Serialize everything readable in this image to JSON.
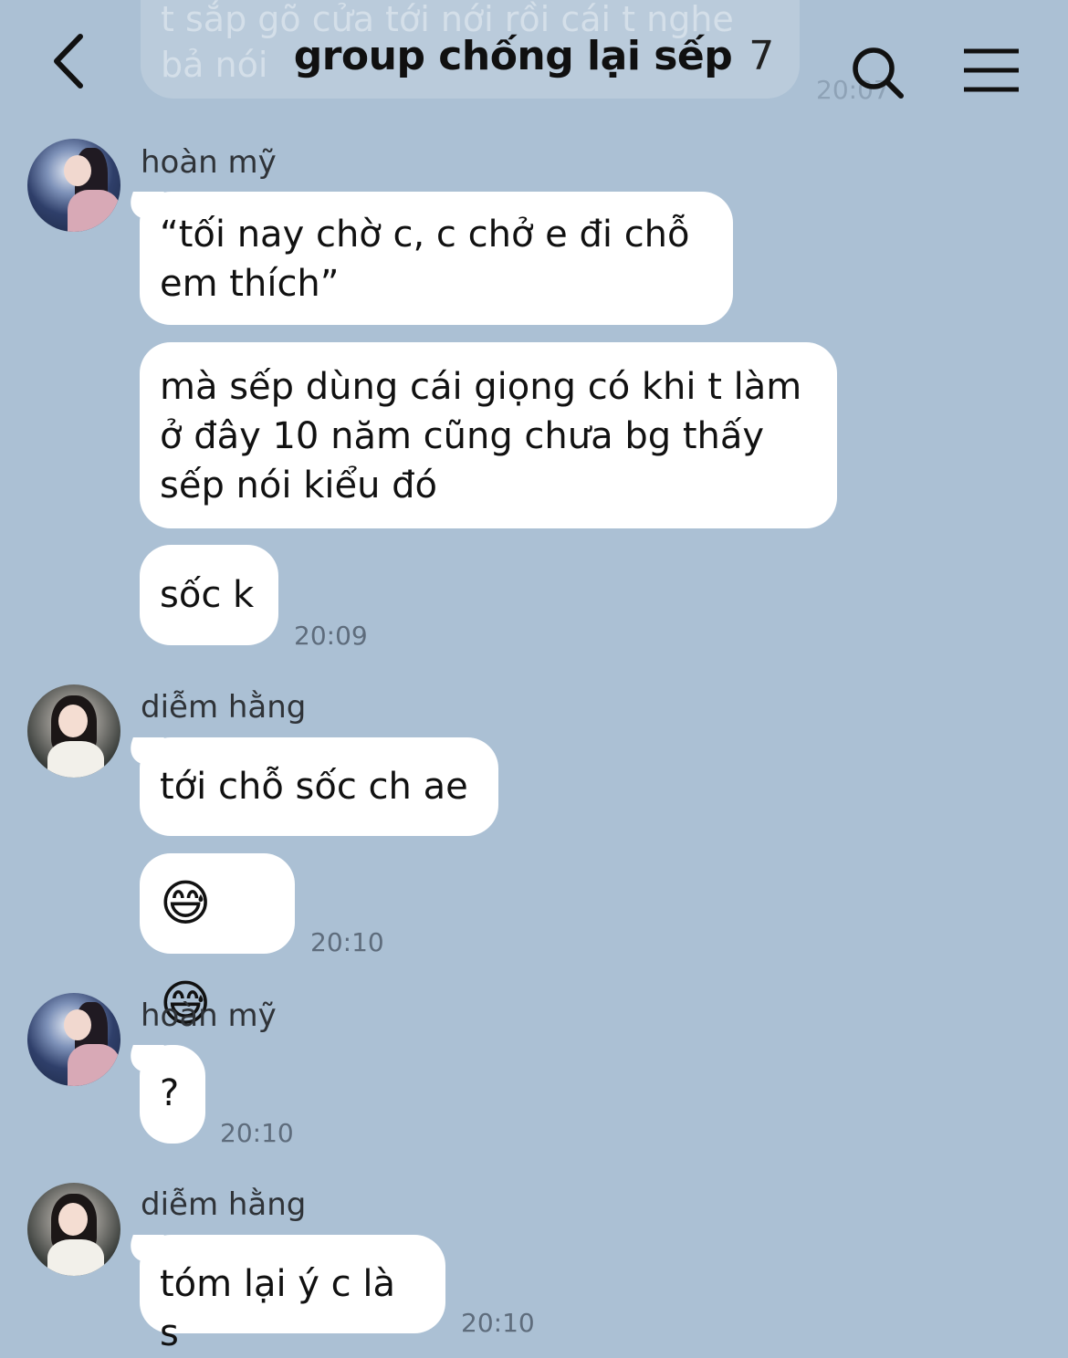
{
  "ghost": {
    "line1": "t sắp gõ cửa tới nới rồi cái t nghe",
    "line2": "bả nói",
    "time": "20:07"
  },
  "header": {
    "title": "group chống lại sếp",
    "member_count": "7",
    "back_icon": "chevron-left-icon",
    "search_icon": "search-icon",
    "menu_icon": "hamburger-menu-icon"
  },
  "messages": [
    {
      "sender": "hoàn mỹ",
      "bubbles": [
        {
          "text": "“tối nay chờ c, c chở e đi chỗ\nem thích”"
        },
        {
          "text": "mà sếp dùng cái giọng có khi t làm\nở đây 10 năm cũng chưa bg thấy\nsếp nói kiểu đó"
        },
        {
          "text": "sốc k",
          "time": "20:09"
        }
      ]
    },
    {
      "sender": "diễm hằng",
      "bubbles": [
        {
          "text": "tới chỗ sốc ch ae"
        },
        {
          "text": "😅 😅",
          "time": "20:10"
        }
      ]
    },
    {
      "sender": "hoàn mỹ",
      "bubbles": [
        {
          "text": "?",
          "time": "20:10"
        }
      ]
    },
    {
      "sender": "diễm hằng",
      "bubbles": [
        {
          "text": "tóm lại ý c là s",
          "time": "20:10"
        }
      ]
    }
  ],
  "colors": {
    "background": "#abc0d4",
    "bubble": "#ffffff",
    "timestamp": "#5e6c7c"
  }
}
